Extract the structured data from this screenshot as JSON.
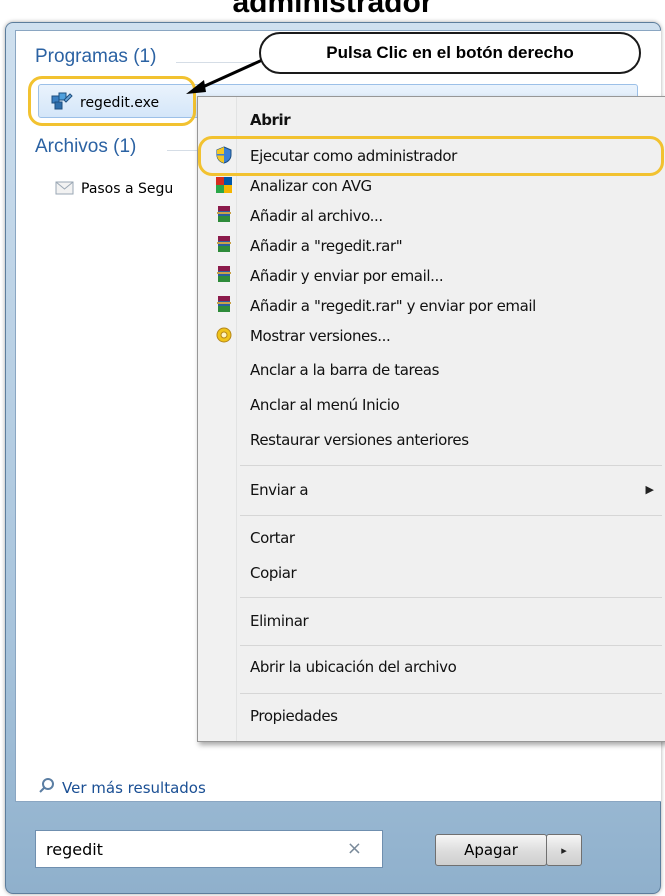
{
  "caption": "administrador",
  "callout": "Pulsa Clic en el botón derecho",
  "colors": {
    "highlight": "#f2c230",
    "header": "#2b62a3",
    "link": "#1a4f94"
  },
  "sections": {
    "programs_header": "Programas (1)",
    "programs_item": "regedit.exe",
    "files_header": "Archivos (1)",
    "files_item": "Pasos a Segu"
  },
  "context_menu": {
    "items": [
      {
        "label": "Abrir",
        "icon": "none"
      },
      {
        "label": "Ejecutar como administrador",
        "icon": "uac-shield-icon"
      },
      {
        "label": "Analizar con AVG",
        "icon": "avg-icon"
      },
      {
        "label": "Añadir al archivo...",
        "icon": "winrar-icon"
      },
      {
        "label": "Añadir a \"regedit.rar\"",
        "icon": "winrar-icon"
      },
      {
        "label": "Añadir y enviar por email...",
        "icon": "winrar-icon"
      },
      {
        "label": "Añadir a \"regedit.rar\" y enviar por email",
        "icon": "winrar-icon"
      },
      {
        "label": "Mostrar versiones...",
        "icon": "versions-icon"
      },
      {
        "label": "Anclar a la barra de tareas",
        "icon": "none"
      },
      {
        "label": "Anclar al menú Inicio",
        "icon": "none"
      },
      {
        "label": "Restaurar versiones anteriores",
        "icon": "none"
      },
      {
        "label": "Enviar a",
        "icon": "none"
      },
      {
        "label": "Cortar",
        "icon": "none"
      },
      {
        "label": "Copiar",
        "icon": "none"
      },
      {
        "label": "Eliminar",
        "icon": "none"
      },
      {
        "label": "Abrir la ubicación del archivo",
        "icon": "none"
      },
      {
        "label": "Propiedades",
        "icon": "none"
      }
    ]
  },
  "more_results": "Ver más resultados",
  "search": {
    "value": "regedit",
    "clear": "×"
  },
  "shutdown": {
    "label": "Apagar",
    "arrow": "▸"
  }
}
